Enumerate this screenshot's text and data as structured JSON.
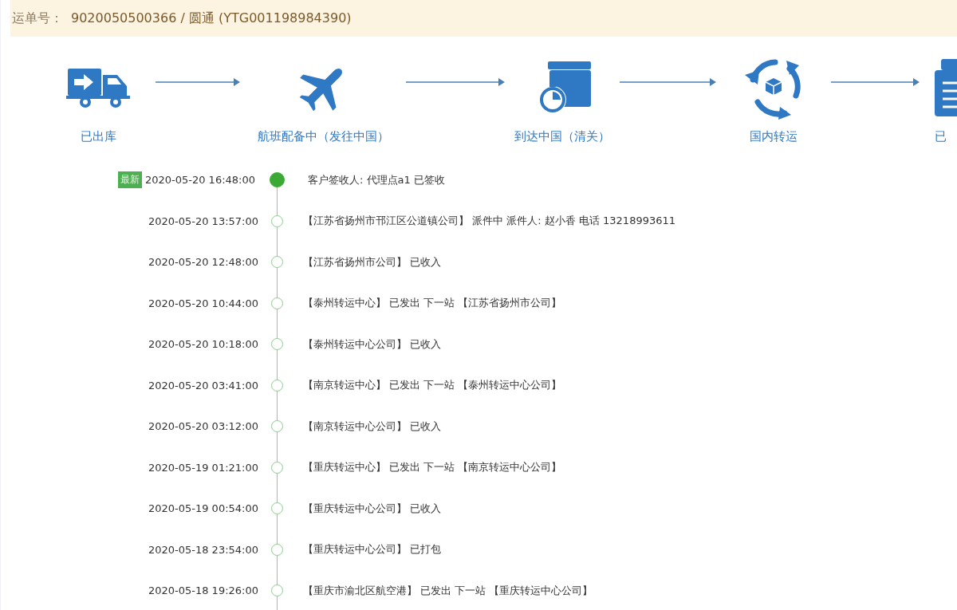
{
  "waybill": {
    "label": "运单号：",
    "value": "9020050500366 / 圆通 (YTG001198984390)"
  },
  "steps": [
    {
      "kind": "truck",
      "label": "已出库"
    },
    {
      "kind": "plane",
      "label": "航班配备中（发往中国）"
    },
    {
      "kind": "customs",
      "label": "到达中国（清关）"
    },
    {
      "kind": "transfer",
      "label": "国内转运"
    },
    {
      "kind": "document",
      "label": "已"
    }
  ],
  "events": [
    {
      "latest": true,
      "badge": "最新",
      "time": "2020-05-20 16:48:00",
      "text": "客户签收人: 代理点a1 已签收"
    },
    {
      "latest": false,
      "time": "2020-05-20 13:57:00",
      "text": "【江苏省扬州市邗江区公道镇公司】 派件中 派件人: 赵小香 电话 13218993611"
    },
    {
      "latest": false,
      "time": "2020-05-20 12:48:00",
      "text": "【江苏省扬州市公司】 已收入"
    },
    {
      "latest": false,
      "time": "2020-05-20 10:44:00",
      "text": "【泰州转运中心】 已发出 下一站 【江苏省扬州市公司】"
    },
    {
      "latest": false,
      "time": "2020-05-20 10:18:00",
      "text": "【泰州转运中心公司】 已收入"
    },
    {
      "latest": false,
      "time": "2020-05-20 03:41:00",
      "text": "【南京转运中心】 已发出 下一站 【泰州转运中心公司】"
    },
    {
      "latest": false,
      "time": "2020-05-20 03:12:00",
      "text": "【南京转运中心公司】 已收入"
    },
    {
      "latest": false,
      "time": "2020-05-19 01:21:00",
      "text": "【重庆转运中心】 已发出 下一站 【南京转运中心公司】"
    },
    {
      "latest": false,
      "time": "2020-05-19 00:54:00",
      "text": "【重庆转运中心公司】 已收入"
    },
    {
      "latest": false,
      "time": "2020-05-18 23:54:00",
      "text": "【重庆转运中心公司】 已打包"
    },
    {
      "latest": false,
      "time": "2020-05-18 19:26:00",
      "text": "【重庆市渝北区航空港】 已发出 下一站 【重庆转运中心公司】"
    }
  ]
}
